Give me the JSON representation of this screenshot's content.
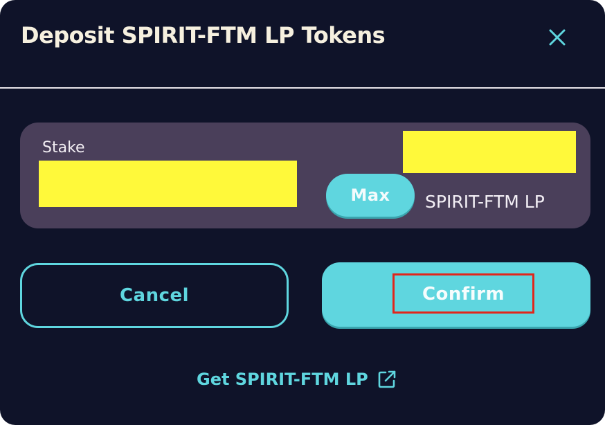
{
  "modal": {
    "title": "Deposit SPIRIT-FTM LP Tokens",
    "close_icon": "close-icon"
  },
  "stake": {
    "label": "Stake",
    "amount_value": "",
    "balance_value": "",
    "max_label": "Max",
    "token_label": "SPIRIT-FTM LP"
  },
  "actions": {
    "cancel_label": "Cancel",
    "confirm_label": "Confirm"
  },
  "footer": {
    "get_lp_label": "Get SPIRIT-FTM LP",
    "external_link_icon": "external-link-icon"
  },
  "colors": {
    "background": "#0f1329",
    "panel": "#4a3f5a",
    "accent": "#5fd6df",
    "title_text": "#f6f0df",
    "redacted_fill": "#fff93a",
    "highlight_box": "#e0261c"
  }
}
